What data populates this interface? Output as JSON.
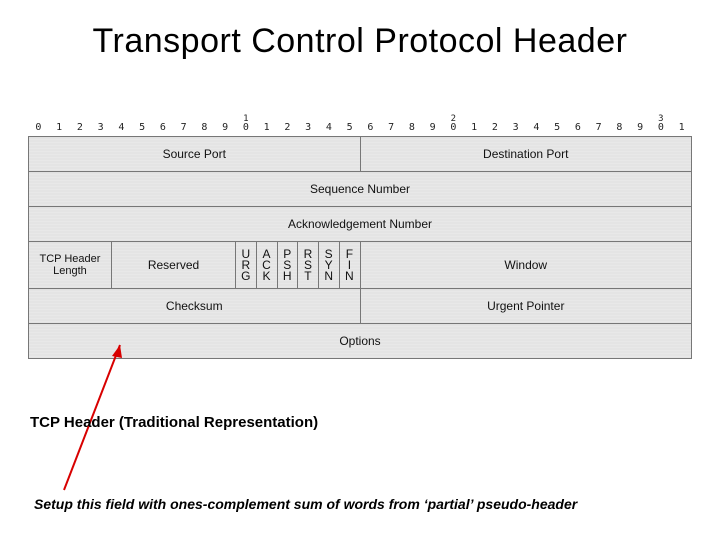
{
  "title": "Transport Control Protocol Header",
  "bit_ruler": {
    "digits": [
      "0",
      "1",
      "2",
      "3",
      "4",
      "5",
      "6",
      "7",
      "8",
      "9",
      "0",
      "1",
      "2",
      "3",
      "4",
      "5",
      "6",
      "7",
      "8",
      "9",
      "0",
      "1",
      "2",
      "3",
      "4",
      "5",
      "6",
      "7",
      "8",
      "9",
      "0",
      "1"
    ],
    "markers": {
      "10": "1",
      "20": "2",
      "30": "3"
    }
  },
  "rows": {
    "r0": {
      "source_port": "Source Port",
      "dest_port": "Destination Port"
    },
    "r1": {
      "seq": "Sequence Number"
    },
    "r2": {
      "ack": "Acknowledgement Number"
    },
    "r3": {
      "hdr_len": "TCP Header Length",
      "reserved": "Reserved",
      "flags": {
        "urg": "U\nR\nG",
        "ack": "A\nC\nK",
        "psh": "P\nS\nH",
        "rst": "R\nS\nT",
        "syn": "S\nY\nN",
        "fin": "F\nI\nN"
      },
      "window": "Window"
    },
    "r4": {
      "checksum": "Checksum",
      "urgent": "Urgent Pointer"
    },
    "r5": {
      "options": "Options"
    }
  },
  "caption": "TCP Header (Traditional Representation)",
  "footnote": "Setup this field with ones-complement sum of words from ‘partial’ pseudo-header"
}
